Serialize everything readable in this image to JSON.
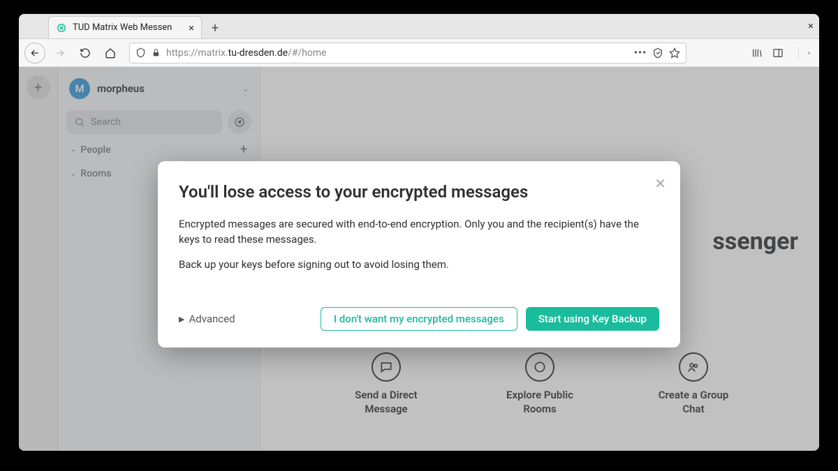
{
  "browser": {
    "tab_title": "TUD Matrix Web Messen",
    "url_prefix": "https://matrix.",
    "url_domain": "tu-dresden.de",
    "url_suffix": "/#/home"
  },
  "sidebar": {
    "avatar_letter": "M",
    "username": "morpheus",
    "search_placeholder": "Search",
    "sections": {
      "people": "People",
      "rooms": "Rooms"
    }
  },
  "main": {
    "welcome_suffix": "ssenger",
    "cards": {
      "dm": "Send a Direct Message",
      "explore": "Explore Public Rooms",
      "group": "Create a Group Chat"
    }
  },
  "modal": {
    "title": "You'll lose access to your encrypted messages",
    "p1": "Encrypted messages are secured with end-to-end encryption. Only you and the recipient(s) have the keys to read these messages.",
    "p2": "Back up your keys before signing out to avoid losing them.",
    "advanced": "Advanced",
    "btn_decline": "I don't want my encrypted messages",
    "btn_accept": "Start using Key Backup"
  }
}
